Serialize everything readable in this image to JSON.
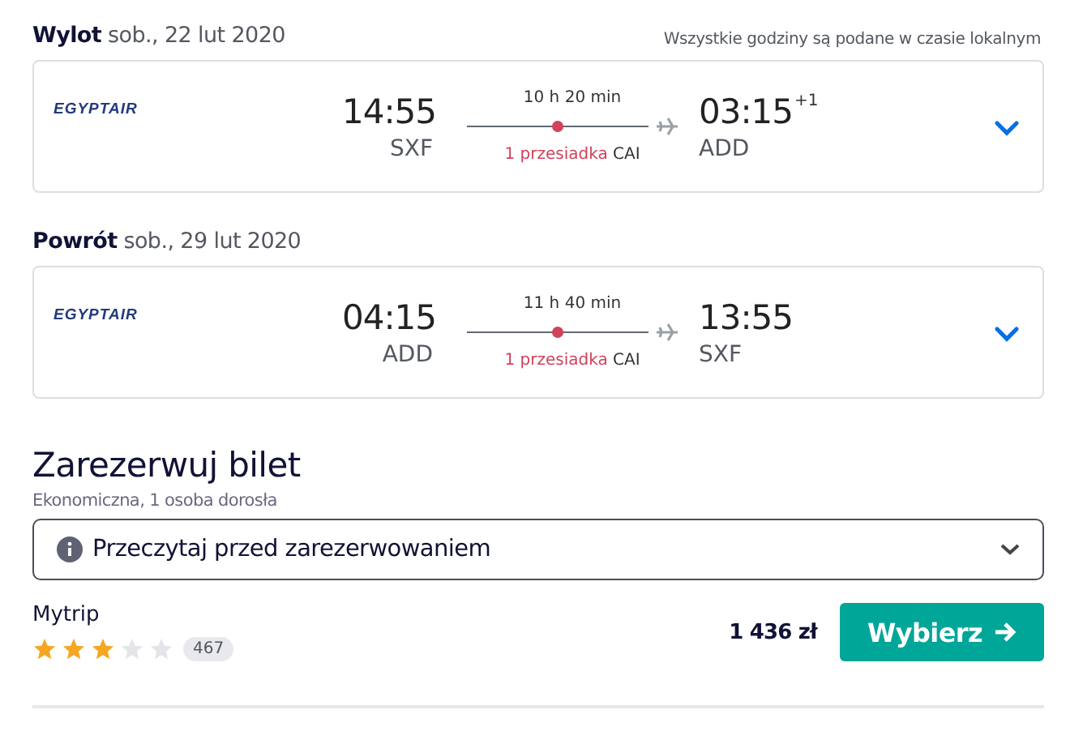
{
  "timezone_note": "Wszystkie godziny są podane w czasie lokalnym",
  "legs": [
    {
      "label": "Wylot",
      "date": "sob., 22 lut 2020",
      "airline": "EGYPTAIR",
      "depart_time": "14:55",
      "depart_airport": "SXF",
      "duration": "10 h 20 min",
      "stops": "1 przesiadka",
      "via": "CAI",
      "arrive_time": "03:15",
      "day_offset": "+1",
      "arrive_airport": "ADD"
    },
    {
      "label": "Powrót",
      "date": "sob., 29 lut 2020",
      "airline": "EGYPTAIR",
      "depart_time": "04:15",
      "depart_airport": "ADD",
      "duration": "11 h 40 min",
      "stops": "1 przesiadka",
      "via": "CAI",
      "arrive_time": "13:55",
      "arrive_airport": "SXF"
    }
  ],
  "booking": {
    "title": "Zarezerwuj bilet",
    "subtitle": "Ekonomiczna, 1 osoba dorosła",
    "notice": "Przeczytaj przed zarezerwowaniem",
    "provider": "Mytrip",
    "stars": 3,
    "reviews": "467",
    "price": "1 436 zł",
    "button": "Wybierz"
  }
}
